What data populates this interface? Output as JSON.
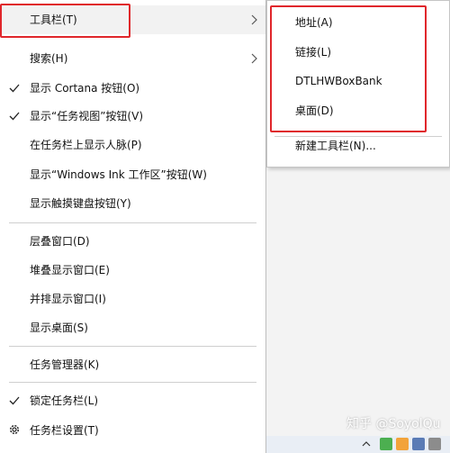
{
  "menu": {
    "items": [
      {
        "label": "工具栏(T)",
        "checked": false,
        "has_submenu": true
      },
      {
        "label": "搜索(H)",
        "checked": false,
        "has_submenu": true
      },
      {
        "label": "显示 Cortana 按钮(O)",
        "checked": true,
        "has_submenu": false
      },
      {
        "label": "显示“任务视图”按钮(V)",
        "checked": true,
        "has_submenu": false
      },
      {
        "label": "在任务栏上显示人脉(P)",
        "checked": false,
        "has_submenu": false
      },
      {
        "label": "显示“Windows Ink 工作区”按钮(W)",
        "checked": false,
        "has_submenu": false
      },
      {
        "label": "显示触摸键盘按钮(Y)",
        "checked": false,
        "has_submenu": false
      },
      {
        "label": "层叠窗口(D)",
        "checked": false,
        "has_submenu": false
      },
      {
        "label": "堆叠显示窗口(E)",
        "checked": false,
        "has_submenu": false
      },
      {
        "label": "并排显示窗口(I)",
        "checked": false,
        "has_submenu": false
      },
      {
        "label": "显示桌面(S)",
        "checked": false,
        "has_submenu": false
      },
      {
        "label": "任务管理器(K)",
        "checked": false,
        "has_submenu": false
      },
      {
        "label": "锁定任务栏(L)",
        "checked": true,
        "has_submenu": false
      },
      {
        "label": "任务栏设置(T)",
        "icon": "gear-icon"
      }
    ]
  },
  "submenu": {
    "items": [
      {
        "label": "地址(A)"
      },
      {
        "label": "链接(L)"
      },
      {
        "label": "DTLHWBoxBank"
      },
      {
        "label": "桌面(D)"
      },
      {
        "label": "新建工具栏(N)..."
      }
    ]
  },
  "watermark": "知乎 @SoyolQu",
  "colors": {
    "highlight_border": "#e0262b",
    "menu_bg": "#ffffff",
    "separator": "#cfcfcf"
  }
}
